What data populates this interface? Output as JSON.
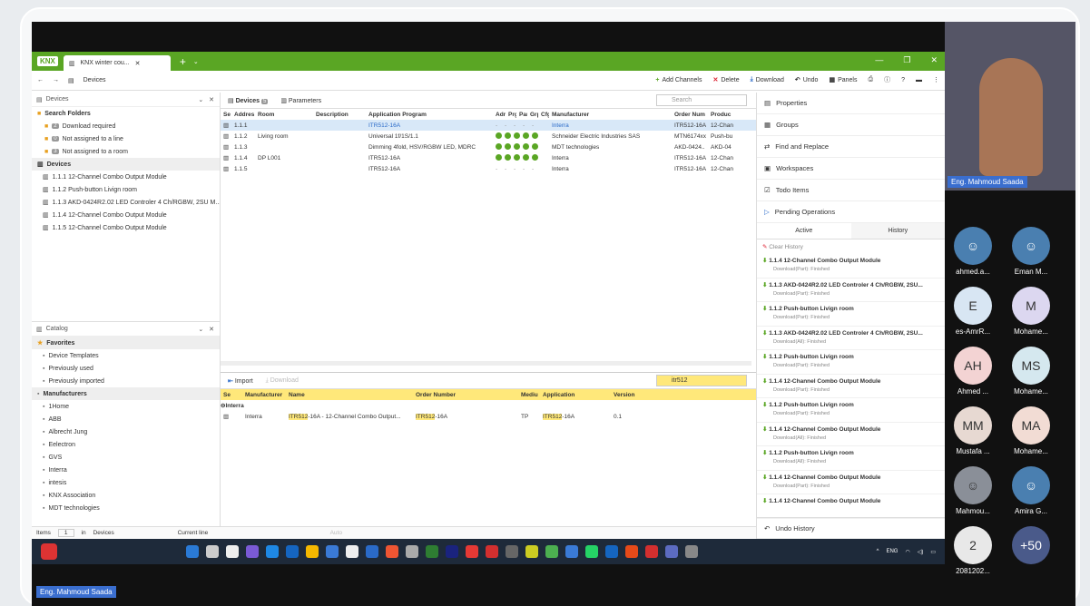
{
  "window": {
    "logo": "KNX",
    "tab_title": "KNX winter cou...",
    "section": "Devices"
  },
  "toolbar": {
    "add": "Add Channels",
    "delete": "Delete",
    "download": "Download",
    "undo": "Undo",
    "panels": "Panels"
  },
  "left": {
    "title": "Devices",
    "items": [
      {
        "label": "Search Folders",
        "kind": "folder",
        "bold": true
      },
      {
        "badge": "2",
        "label": "Download required",
        "kind": "sub"
      },
      {
        "badge": "0",
        "label": "Not assigned to a line",
        "kind": "sub"
      },
      {
        "badge": "3",
        "label": "Not assigned to a room",
        "kind": "sub"
      },
      {
        "label": "Devices",
        "kind": "sel"
      },
      {
        "label": "1.1.1 12-Channel Combo Output Module",
        "kind": "dev"
      },
      {
        "label": "1.1.2 Push-button Livign room",
        "kind": "dev"
      },
      {
        "label": "1.1.3 AKD-0424R2.02 LED Controler 4 Ch/RGBW, 2SU M...",
        "kind": "dev"
      },
      {
        "label": "1.1.4 12-Channel Combo Output Module",
        "kind": "dev"
      },
      {
        "label": "1.1.5 12-Channel Combo Output Module",
        "kind": "dev"
      }
    ]
  },
  "catalog": {
    "title": "Catalog",
    "items": [
      {
        "label": "Favorites",
        "bold": true
      },
      {
        "label": "Device Templates"
      },
      {
        "label": "Previously used"
      },
      {
        "label": "Previously imported"
      },
      {
        "label": "Manufacturers",
        "bold": true
      },
      {
        "label": "1Home"
      },
      {
        "label": "ABB"
      },
      {
        "label": "Albrecht Jung"
      },
      {
        "label": "Eelectron"
      },
      {
        "label": "GVS"
      },
      {
        "label": "Interra"
      },
      {
        "label": "intesis"
      },
      {
        "label": "KNX Association"
      },
      {
        "label": "MDT technologies"
      }
    ]
  },
  "center": {
    "tab1": "Devices",
    "tab1_count": "5",
    "tab2": "Parameters",
    "search_placeholder": "Search",
    "headers": [
      "Se",
      "Addres",
      "Room",
      "Description",
      "Application Program",
      "Adr",
      "Prg",
      "Par",
      "Grp",
      "Cfg",
      "Manufacturer",
      "Order Num",
      "Produc"
    ],
    "rows": [
      {
        "addr": "1.1.1",
        "room": "",
        "desc": "",
        "app": "ITR512-16A",
        "status": "dash",
        "mfr": "Interra",
        "order": "ITR512-16A",
        "prod": "12-Chan",
        "sel": true
      },
      {
        "addr": "1.1.2",
        "room": "Living room",
        "desc": "",
        "app": "Universal 1f/1S/1.1",
        "status": "ok",
        "mfr": "Schneider Electric Industries SAS",
        "order": "MTN6174xx",
        "prod": "Push-bu",
        "sel": false
      },
      {
        "addr": "1.1.3",
        "room": "",
        "desc": "",
        "app": "Dimming 4fold, HSV/RGBW LED, MDRC",
        "status": "ok",
        "mfr": "MDT technologies",
        "order": "AKD-0424..",
        "prod": "AKD-04",
        "sel": false
      },
      {
        "addr": "1.1.4",
        "room": "DP L001",
        "desc": "",
        "app": "ITR512-16A",
        "status": "ok",
        "mfr": "Interra",
        "order": "ITR512-16A",
        "prod": "12-Chan",
        "sel": false
      },
      {
        "addr": "1.1.5",
        "room": "",
        "desc": "",
        "app": "ITR512-16A",
        "status": "dash",
        "mfr": "Interra",
        "order": "ITR512-16A",
        "prod": "12-Chan",
        "sel": false
      }
    ]
  },
  "lower": {
    "import": "Import",
    "download": "Download",
    "search": "itr512",
    "headers": [
      "Se",
      "Manufacturer",
      "Name",
      "Order Number",
      "Mediu",
      "Application",
      "Version"
    ],
    "group": "Interra",
    "row": {
      "mfr": "Interra",
      "name_hl": "ITR512",
      "name_rest": "-16A - 12-Channel Combo Output...",
      "order_hl": "ITR512",
      "order_rest": "-16A",
      "medium": "TP",
      "app_hl": "ITR512",
      "app_rest": "-16A",
      "version": "0.1"
    }
  },
  "statusbar": {
    "items_label": "Items",
    "items_value": "1",
    "in": "in",
    "scope": "Devices",
    "line": "Current line",
    "auto": "Auto"
  },
  "right": {
    "properties": "Properties",
    "groups": "Groups",
    "find": "Find and Replace",
    "workspaces": "Workspaces",
    "todo": "Todo Items",
    "pending": "Pending Operations",
    "active": "Active",
    "history": "History",
    "clear": "Clear History",
    "undo_history": "Undo History",
    "entries": [
      {
        "t": "1.1.4 12-Channel Combo Output Module",
        "s": "Download(Part): Finished"
      },
      {
        "t": "1.1.3 AKD-0424R2.02 LED Controler 4 Ch/RGBW, 2SU...",
        "s": "Download(Part): Finished"
      },
      {
        "t": "1.1.2 Push-button Livign room",
        "s": "Download(Part): Finished"
      },
      {
        "t": "1.1.3 AKD-0424R2.02 LED Controler 4 Ch/RGBW, 2SU...",
        "s": "Download(All): Finished"
      },
      {
        "t": "1.1.2 Push-button Livign room",
        "s": "Download(Part): Finished"
      },
      {
        "t": "1.1.4 12-Channel Combo Output Module",
        "s": "Download(Part): Finished"
      },
      {
        "t": "1.1.2 Push-button Livign room",
        "s": "Download(Part): Finished"
      },
      {
        "t": "1.1.4 12-Channel Combo Output Module",
        "s": "Download(All): Finished"
      },
      {
        "t": "1.1.2 Push-button Livign room",
        "s": "Download(All): Finished"
      },
      {
        "t": "1.1.4 12-Channel Combo Output Module",
        "s": "Download(Part): Finished"
      },
      {
        "t": "1.1.4 12-Channel Combo Output Module",
        "s": ""
      }
    ]
  },
  "taskbar": {
    "lang": "ENG"
  },
  "meeting": {
    "presenter": "Eng. Mahmoud Saada",
    "bottom_name": "Eng. Mahmoud Saada",
    "participants": [
      {
        "initials": "",
        "name": "ahmed.a...",
        "color": "#4a7fb0"
      },
      {
        "initials": "",
        "name": "Eman M...",
        "color": "#4a7fb0"
      },
      {
        "initials": "E",
        "name": "es-AmrR...",
        "color": "#d8e6f3"
      },
      {
        "initials": "M",
        "name": "Mohame...",
        "color": "#dcd7f0"
      },
      {
        "initials": "AH",
        "name": "Ahmed ...",
        "color": "#f3d3d3"
      },
      {
        "initials": "MS",
        "name": "Mohame...",
        "color": "#d5e8ef"
      },
      {
        "initials": "MM",
        "name": "Mustafa ...",
        "color": "#e7d9d2"
      },
      {
        "initials": "MA",
        "name": "Mohame...",
        "color": "#f2dcd4"
      },
      {
        "initials": "",
        "name": "Mahmou...",
        "color": "#8a8f98"
      },
      {
        "initials": "",
        "name": "Amira G...",
        "color": "#4a7fb0"
      },
      {
        "initials": "2",
        "name": "2081202...",
        "color": "#e8e8e8"
      },
      {
        "initials": "+50",
        "name": "",
        "color": "#4a5a8a"
      }
    ]
  }
}
